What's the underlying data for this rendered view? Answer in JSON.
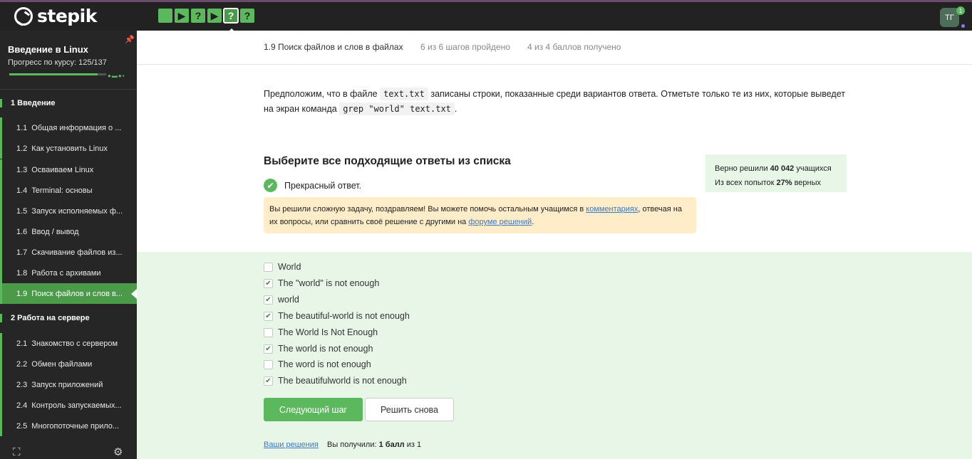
{
  "app": {
    "logo_text": "stepik",
    "avatar_initials": "ТГ",
    "notification_count": "1"
  },
  "step_nav": [
    "",
    "▶",
    "?",
    "▶",
    "?",
    "?"
  ],
  "sidebar": {
    "course_title": "Введение в Linux",
    "progress_label": "Прогресс по курсу:  125/137",
    "progress_fraction": 0.912,
    "modules": [
      {
        "label": "1  Введение",
        "lessons": [
          {
            "num": "1.1",
            "label": "Общая информация о ..."
          },
          {
            "num": "1.2",
            "label": "Как установить Linux"
          },
          {
            "num": "1.3",
            "label": "Осваиваем Linux"
          },
          {
            "num": "1.4",
            "label": "Terminal: основы"
          },
          {
            "num": "1.5",
            "label": "Запуск исполняемых ф..."
          },
          {
            "num": "1.6",
            "label": "Ввод / вывод"
          },
          {
            "num": "1.7",
            "label": "Скачивание файлов из..."
          },
          {
            "num": "1.8",
            "label": "Работа с архивами"
          },
          {
            "num": "1.9",
            "label": "Поиск файлов и слов в..."
          }
        ]
      },
      {
        "label": "2  Работа на сервере",
        "lessons": [
          {
            "num": "2.1",
            "label": "Знакомство с сервером"
          },
          {
            "num": "2.2",
            "label": "Обмен файлами"
          },
          {
            "num": "2.3",
            "label": "Запуск приложений"
          },
          {
            "num": "2.4",
            "label": "Контроль запускаемых..."
          },
          {
            "num": "2.5",
            "label": "Многопоточные прило..."
          }
        ]
      }
    ]
  },
  "header": {
    "lesson_title": "1.9 Поиск файлов и слов в файлах",
    "steps_done": "6 из 6 шагов пройдено",
    "points": "4 из 4 баллов  получено"
  },
  "question": {
    "part1": "Предположим, что в файле ",
    "code1": "text.txt",
    "part2": " записаны строки, показанные среди вариантов ответа. Отметьте только те из них, которые выведет на экран команда ",
    "code2": "grep \"world\" text.txt",
    "part3": "."
  },
  "task": {
    "title": "Выберите все подходящие ответы из списка",
    "result_text": "Прекрасный ответ.",
    "stats_line1_pre": "Верно решили ",
    "stats_line1_num": "40 042",
    "stats_line1_post": " учащихся",
    "stats_line2_pre": "Из всех попыток ",
    "stats_line2_num": "27%",
    "stats_line2_post": " верных",
    "notice_pre": "Вы решили сложную задачу, поздравляем! Вы можете помочь остальным учащимся в ",
    "notice_link1": "комментариях",
    "notice_mid": ", отвечая на их вопросы, или сравнить своё решение с другими на ",
    "notice_link2": "форуме решений",
    "notice_post": "."
  },
  "options": [
    {
      "label": "World",
      "checked": false
    },
    {
      "label": "The \"world\" is not enough",
      "checked": true
    },
    {
      "label": "world",
      "checked": true
    },
    {
      "label": "The beautiful-world is not enough",
      "checked": true
    },
    {
      "label": "The World Is Not Enough",
      "checked": false
    },
    {
      "label": "The world is not enough",
      "checked": true
    },
    {
      "label": "The word is not enough",
      "checked": false
    },
    {
      "label": "The beautifulworld is not enough",
      "checked": true
    }
  ],
  "actions": {
    "next_label": "Следующий шаг",
    "retry_label": "Решить снова",
    "solutions_link": "Ваши решения",
    "score_pre": "Вы получили: ",
    "score_bold": "1 балл",
    "score_post": " из 1"
  }
}
